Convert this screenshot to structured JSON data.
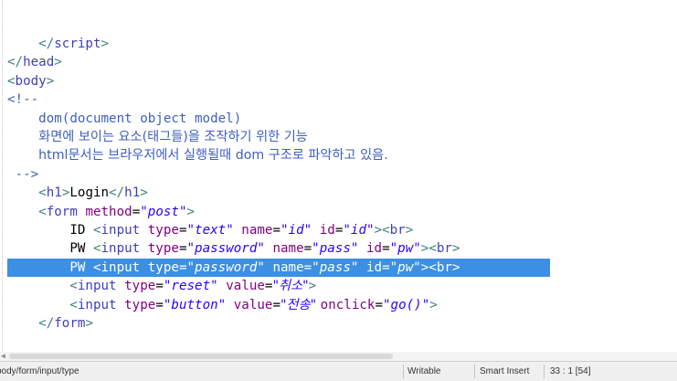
{
  "editor": {
    "lines": [
      {
        "indent": "    ",
        "segments": [
          {
            "cls": "tag",
            "t": "</"
          },
          {
            "cls": "tagname",
            "t": "script"
          },
          {
            "cls": "tag",
            "t": ">"
          }
        ]
      },
      {
        "indent": "",
        "segments": [
          {
            "cls": "tag",
            "t": "</"
          },
          {
            "cls": "tagname",
            "t": "head"
          },
          {
            "cls": "tag",
            "t": ">"
          }
        ]
      },
      {
        "indent": "",
        "segments": [
          {
            "cls": "tag",
            "t": "<"
          },
          {
            "cls": "tagname",
            "t": "body"
          },
          {
            "cls": "tag",
            "t": ">"
          }
        ]
      },
      {
        "indent": "",
        "segments": [
          {
            "cls": "comment",
            "t": "<!--"
          }
        ]
      },
      {
        "indent": "    ",
        "segments": [
          {
            "cls": "comment",
            "t": "dom(document object model)"
          }
        ]
      },
      {
        "indent": "    ",
        "segments": [
          {
            "cls": "comment ko",
            "t": "화면에 보이는 요소(태그들)을 조작하기 위한 기능"
          }
        ]
      },
      {
        "indent": "    ",
        "segments": [
          {
            "cls": "comment ko",
            "t": "html문서는 브라우저에서 실행될때 dom 구조로 파악하고 있음."
          }
        ]
      },
      {
        "indent": " ",
        "segments": [
          {
            "cls": "comment",
            "t": "-->"
          }
        ]
      },
      {
        "indent": "    ",
        "segments": [
          {
            "cls": "tag",
            "t": "<"
          },
          {
            "cls": "tagname",
            "t": "h1"
          },
          {
            "cls": "tag",
            "t": ">"
          },
          {
            "cls": "plain",
            "t": "Login"
          },
          {
            "cls": "tag",
            "t": "</"
          },
          {
            "cls": "tagname",
            "t": "h1"
          },
          {
            "cls": "tag",
            "t": ">"
          }
        ]
      },
      {
        "indent": "    ",
        "segments": [
          {
            "cls": "tag",
            "t": "<"
          },
          {
            "cls": "tagname",
            "t": "form "
          },
          {
            "cls": "attr",
            "t": "method"
          },
          {
            "cls": "plain",
            "t": "="
          },
          {
            "cls": "val",
            "t": "\"post\""
          },
          {
            "cls": "tag",
            "t": ">"
          }
        ]
      },
      {
        "indent": "        ",
        "segments": [
          {
            "cls": "plain",
            "t": "ID "
          },
          {
            "cls": "tag",
            "t": "<"
          },
          {
            "cls": "tagname",
            "t": "input "
          },
          {
            "cls": "attr",
            "t": "type"
          },
          {
            "cls": "plain",
            "t": "="
          },
          {
            "cls": "val",
            "t": "\"text\" "
          },
          {
            "cls": "attr",
            "t": "name"
          },
          {
            "cls": "plain",
            "t": "="
          },
          {
            "cls": "val",
            "t": "\"id\" "
          },
          {
            "cls": "attr",
            "t": "id"
          },
          {
            "cls": "plain",
            "t": "="
          },
          {
            "cls": "val",
            "t": "\"id\""
          },
          {
            "cls": "tag",
            "t": "><"
          },
          {
            "cls": "tagname",
            "t": "br"
          },
          {
            "cls": "tag",
            "t": ">"
          }
        ]
      },
      {
        "indent": "        ",
        "segments": [
          {
            "cls": "plain",
            "t": "PW "
          },
          {
            "cls": "tag",
            "t": "<"
          },
          {
            "cls": "tagname",
            "t": "input "
          },
          {
            "cls": "attr",
            "t": "type"
          },
          {
            "cls": "plain",
            "t": "="
          },
          {
            "cls": "val",
            "t": "\"password\" "
          },
          {
            "cls": "attr",
            "t": "name"
          },
          {
            "cls": "plain",
            "t": "="
          },
          {
            "cls": "val",
            "t": "\"pass\" "
          },
          {
            "cls": "attr",
            "t": "id"
          },
          {
            "cls": "plain",
            "t": "="
          },
          {
            "cls": "val",
            "t": "\"pw\""
          },
          {
            "cls": "tag",
            "t": "><"
          },
          {
            "cls": "tagname",
            "t": "br"
          },
          {
            "cls": "tag",
            "t": ">"
          }
        ]
      },
      {
        "indent": "        ",
        "selected": true,
        "segments": [
          {
            "cls": "plain",
            "t": "PW "
          },
          {
            "cls": "tag",
            "t": "<"
          },
          {
            "cls": "tagname",
            "t": "input "
          },
          {
            "cls": "attr",
            "t": "type"
          },
          {
            "cls": "plain",
            "t": "="
          },
          {
            "cls": "val",
            "t": "\"password\" "
          },
          {
            "cls": "attr",
            "t": "name"
          },
          {
            "cls": "plain",
            "t": "="
          },
          {
            "cls": "val",
            "t": "\"pass\" "
          },
          {
            "cls": "attr",
            "t": "id"
          },
          {
            "cls": "plain",
            "t": "="
          },
          {
            "cls": "val",
            "t": "\"pw\""
          },
          {
            "cls": "tag",
            "t": "><"
          },
          {
            "cls": "tagname",
            "t": "br"
          },
          {
            "cls": "tag",
            "t": ">"
          }
        ]
      },
      {
        "indent": "        ",
        "segments": [
          {
            "cls": "tag",
            "t": "<"
          },
          {
            "cls": "tagname",
            "t": "input "
          },
          {
            "cls": "attr",
            "t": "type"
          },
          {
            "cls": "plain",
            "t": "="
          },
          {
            "cls": "val",
            "t": "\"reset\" "
          },
          {
            "cls": "attr",
            "t": "value"
          },
          {
            "cls": "plain",
            "t": "="
          },
          {
            "cls": "val ko",
            "t": "\"취소\""
          },
          {
            "cls": "tag",
            "t": ">"
          }
        ]
      },
      {
        "indent": "        ",
        "segments": [
          {
            "cls": "tag",
            "t": "<"
          },
          {
            "cls": "tagname",
            "t": "input "
          },
          {
            "cls": "attr",
            "t": "type"
          },
          {
            "cls": "plain",
            "t": "="
          },
          {
            "cls": "val",
            "t": "\"button\" "
          },
          {
            "cls": "attr",
            "t": "value"
          },
          {
            "cls": "plain",
            "t": "="
          },
          {
            "cls": "val ko",
            "t": "\"전송\" "
          },
          {
            "cls": "attr",
            "t": "onclick"
          },
          {
            "cls": "plain",
            "t": "="
          },
          {
            "cls": "val",
            "t": "\"go()\""
          },
          {
            "cls": "tag",
            "t": ">"
          }
        ]
      },
      {
        "indent": "    ",
        "segments": [
          {
            "cls": "tag",
            "t": "</"
          },
          {
            "cls": "tagname",
            "t": "form"
          },
          {
            "cls": "tag",
            "t": ">"
          }
        ]
      }
    ]
  },
  "statusbar": {
    "breadcrumb": "body/form/input/type",
    "mode": "Writable",
    "insert_mode": "Smart Insert",
    "position": "33 : 1 [54]"
  }
}
